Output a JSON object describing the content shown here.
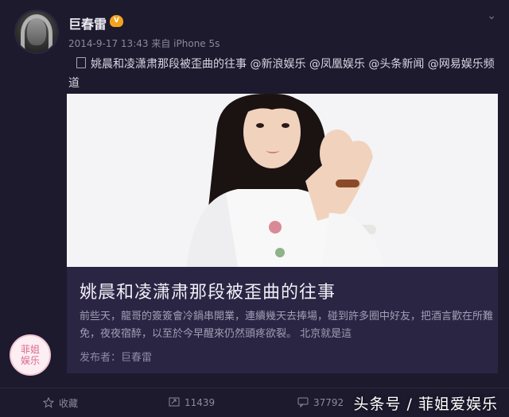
{
  "post": {
    "username": "巨春雷",
    "badge": "V",
    "timestamp": "2014-9-17 13:43",
    "source_prefix": "来自",
    "device": "iPhone 5s",
    "text": "姚晨和凌潇肃那段被歪曲的往事 @新浪娱乐 @凤凰娱乐 @头条新闻 @网易娱乐频道"
  },
  "card": {
    "title": "姚晨和凌潇肃那段被歪曲的往事",
    "description": "前些天，龍哥的簽簽會冷鍋串開業，連續幾天去捧場，碰到許多圈中好友，把酒言歡在所難免，夜夜宿醉，以至於今早醒來仍然頭疼欲裂。 北京就是這",
    "publisher_label": "发布者：",
    "publisher": "巨春雷"
  },
  "actions": {
    "favorite": "收藏",
    "repost_count": "11439",
    "comment_count": "37792"
  },
  "watermark": {
    "logo_text_line1": "菲姐",
    "logo_text_line2": "娱乐",
    "source": "头条号 / 菲姐爱娱乐"
  },
  "colors": {
    "background": "#1d1a2e",
    "card": "#2b2544",
    "badge": "#f4a21e"
  },
  "icons": {
    "chevron": "chevron-down-icon",
    "doc": "document-icon",
    "star": "star-icon",
    "repost": "repost-icon",
    "comment": "comment-icon"
  }
}
